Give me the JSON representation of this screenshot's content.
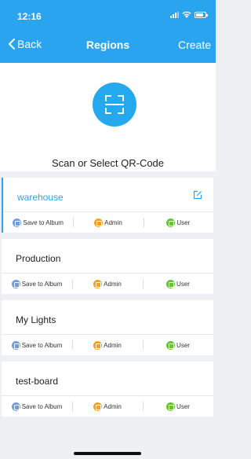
{
  "status_bar": {
    "time": "12:16"
  },
  "nav": {
    "back_label": "Back",
    "title": "Regions",
    "create_label": "Create"
  },
  "scan": {
    "text": "Scan or Select QR-Code",
    "icon": "scan-qr-icon"
  },
  "regions": [
    {
      "name": "warehouse",
      "active": true
    },
    {
      "name": "Production",
      "active": false
    },
    {
      "name": "My Lights",
      "active": false
    },
    {
      "name": "test-board",
      "active": false
    }
  ],
  "actions": {
    "save_label": "Save to Album",
    "admin_label": "Admin",
    "user_label": "User"
  },
  "colors": {
    "header": "#2aa4ef",
    "accent": "#2aa4ef",
    "admin": "#f0a126",
    "user": "#67c23a",
    "album": "#6f9ed9"
  }
}
